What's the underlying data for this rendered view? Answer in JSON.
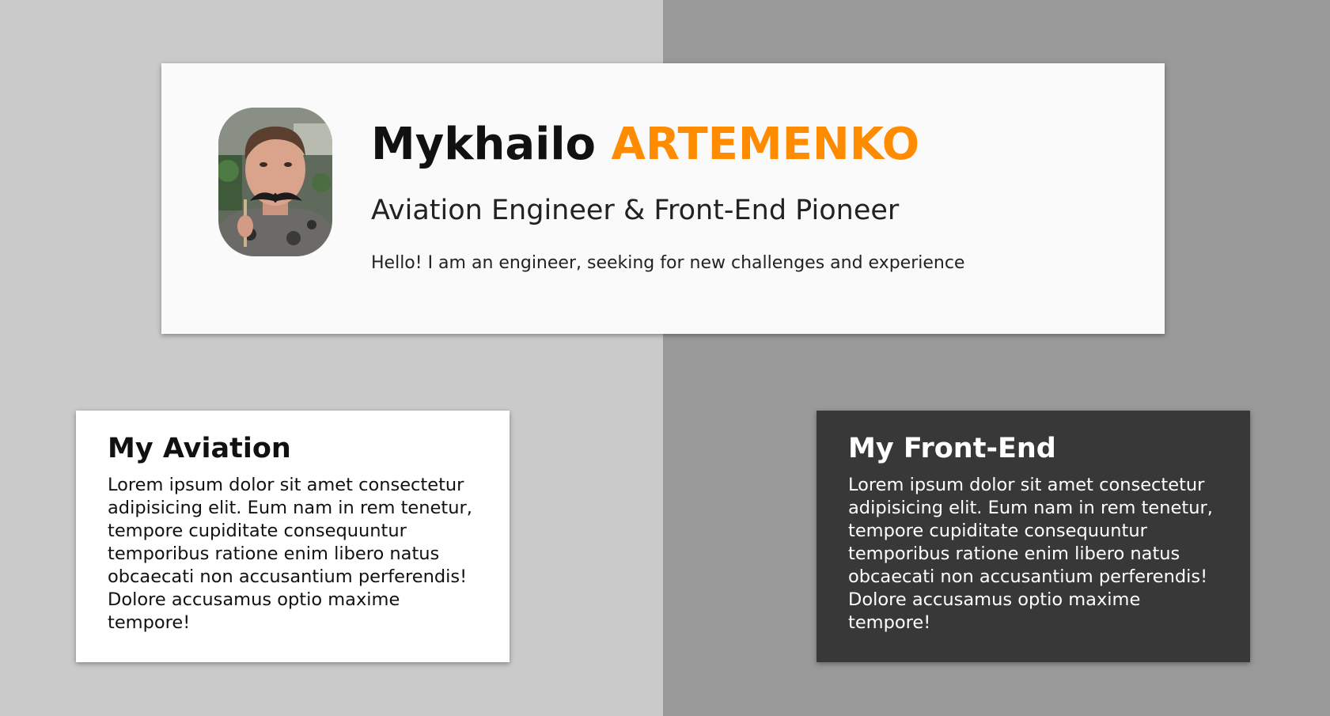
{
  "colors": {
    "left_background": "#cacaca",
    "right_background": "#999999",
    "accent": "#ff8c00",
    "header_card": "#fafafa",
    "aviation_card": "#ffffff",
    "frontend_card": "#383838"
  },
  "header": {
    "avatar_icon": "profile-photo",
    "first_name": "Mykhailo",
    "last_name": "ARTEMENKO",
    "role": "Aviation Engineer & Front-End Pioneer",
    "greeting": "Hello! I am an engineer, seeking for new challenges and experience"
  },
  "cards": {
    "aviation": {
      "title": "My Aviation",
      "text": "Lorem ipsum dolor sit amet consectetur adipisicing elit. Eum nam in rem tenetur, tempore cupiditate consequuntur temporibus ratione enim libero natus obcaecati non accusantium perferendis! Dolore accusamus optio maxime tempore!"
    },
    "frontend": {
      "title": "My Front-End",
      "text": "Lorem ipsum dolor sit amet consectetur adipisicing elit. Eum nam in rem tenetur, tempore cupiditate consequuntur temporibus ratione enim libero natus obcaecati non accusantium perferendis! Dolore accusamus optio maxime tempore!"
    }
  }
}
